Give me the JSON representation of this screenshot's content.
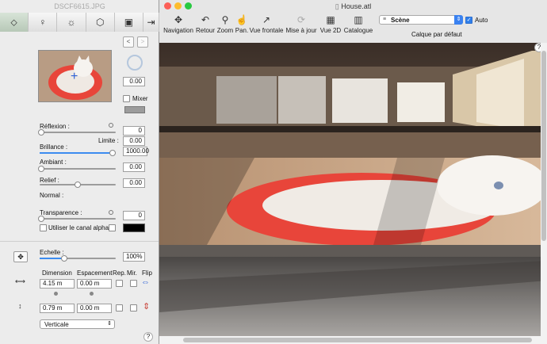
{
  "left_panel": {
    "title": "DSCF6615.JPG",
    "tabs": [
      {
        "icon": "paint-bucket-icon",
        "glyph": "⬦"
      },
      {
        "icon": "bulb-icon",
        "glyph": "♀"
      },
      {
        "icon": "sun-icon",
        "glyph": "☼"
      },
      {
        "icon": "cube-icon",
        "glyph": "⬡"
      },
      {
        "icon": "camera-icon",
        "glyph": "▣"
      },
      {
        "icon": "export-icon",
        "glyph": "⇥"
      }
    ],
    "nav_prev": "<",
    "nav_next": ">",
    "rotation_value": "0.00",
    "mixer_label": "Mixer",
    "reflexion_label": "Réflexion :",
    "reflexion_value": "0",
    "limite_label": "Limite :",
    "limite_value": "0.00",
    "brillance_label": "Brillance :",
    "brillance_value": "1000.00",
    "ambiant_label": "Ambiant :",
    "ambiant_value": "0.00",
    "relief_label": "Relief :",
    "relief_value": "0.00",
    "normal_label": "Normal :",
    "transparence_label": "Transparence :",
    "transparence_value": "0",
    "alpha_label": "Utiliser le canal alpha",
    "echelle_label": "Echelle :",
    "echelle_value": "100%",
    "dimension_label": "Dimension",
    "espacement_label": "Espacement",
    "rep_label": "Rep.",
    "mir_label": "Mir.",
    "flip_label": "Flip",
    "dim_h_value": "4.15 m",
    "esp_h_value": "0.00 m",
    "dim_v_value": "0.79 m",
    "esp_v_value": "0.00 m",
    "orientation_value": "Verticale",
    "help": "?"
  },
  "window": {
    "title": "House.atl",
    "tools": [
      {
        "label": "Navigation",
        "icon": "navigation-icon",
        "glyph": "✥"
      },
      {
        "label": "Retour",
        "icon": "undo-icon",
        "glyph": "↶"
      },
      {
        "label": "Zoom",
        "icon": "zoom-icon",
        "glyph": "⚲"
      },
      {
        "label": "Pan.",
        "icon": "pan-icon",
        "glyph": "☝"
      },
      {
        "label": "Vue frontale",
        "icon": "front-view-icon",
        "glyph": "↗"
      },
      {
        "label": "Mise à jour",
        "icon": "update-icon",
        "glyph": "⟳"
      },
      {
        "label": "Vue 2D",
        "icon": "view-2d-icon",
        "glyph": "▦"
      },
      {
        "label": "Catalogue",
        "icon": "catalog-icon",
        "glyph": "▥"
      }
    ],
    "layer_select": "Scène",
    "auto_label": "Auto",
    "layer_caption": "Calque par défaut",
    "help": "?"
  },
  "colors": {
    "accent": "#2f7fea",
    "plate_red": "#e8453a"
  }
}
